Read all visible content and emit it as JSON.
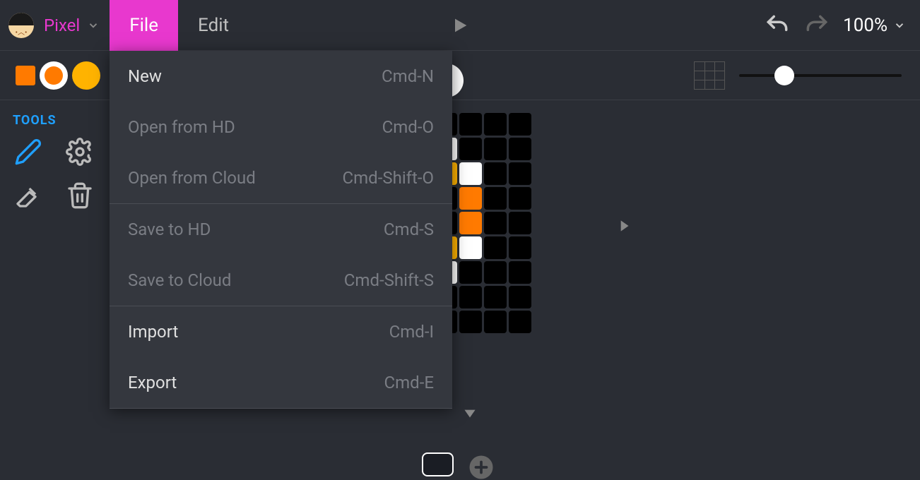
{
  "menubar": {
    "mode_label": "Pixel",
    "tabs": {
      "file": "File",
      "edit": "Edit"
    },
    "zoom_label": "100%"
  },
  "optionsbar": {
    "swatch_square_color": "#ff7a00",
    "swatch_circle_white_inner": "#ff7a00",
    "swatch_circle_orange": "#ffb300"
  },
  "tools": {
    "title": "TOOLS"
  },
  "file_menu": [
    {
      "label": "New",
      "shortcut": "Cmd-N",
      "disabled": false
    },
    {
      "label": "Open from HD",
      "shortcut": "Cmd-O",
      "disabled": true
    },
    {
      "label": "Open from Cloud",
      "shortcut": "Cmd-Shift-O",
      "disabled": true
    },
    {
      "divider": true
    },
    {
      "label": "Save to HD",
      "shortcut": "Cmd-S",
      "disabled": true
    },
    {
      "label": "Save to Cloud",
      "shortcut": "Cmd-Shift-S",
      "disabled": true
    },
    {
      "divider": true
    },
    {
      "label": "Import",
      "shortcut": "Cmd-I",
      "disabled": false
    },
    {
      "label": "Export",
      "shortcut": "Cmd-E",
      "disabled": false
    },
    {
      "divider": true
    }
  ],
  "pixel_grid": {
    "rows": 9,
    "cols": 9,
    "colors": {
      "k": "#000000",
      "w": "#ffffff",
      "o": "#ff7a00",
      "y": "#ffb300"
    },
    "data": [
      [
        "k",
        "k",
        "k",
        "k",
        "k",
        "k",
        "k",
        "k",
        "k"
      ],
      [
        "k",
        "k",
        "k",
        "k",
        "w",
        "w",
        "k",
        "k",
        "k"
      ],
      [
        "k",
        "k",
        "k",
        "k",
        "k",
        "y",
        "w",
        "k",
        "k"
      ],
      [
        "k",
        "k",
        "k",
        "k",
        "k",
        "k",
        "o",
        "k",
        "k"
      ],
      [
        "k",
        "k",
        "k",
        "k",
        "k",
        "k",
        "o",
        "k",
        "k"
      ],
      [
        "k",
        "k",
        "k",
        "k",
        "k",
        "y",
        "w",
        "k",
        "k"
      ],
      [
        "k",
        "k",
        "k",
        "k",
        "w",
        "w",
        "k",
        "k",
        "k"
      ],
      [
        "k",
        "k",
        "k",
        "k",
        "w",
        "k",
        "k",
        "k",
        "k"
      ],
      [
        "k",
        "k",
        "k",
        "k",
        "w",
        "k",
        "k",
        "k",
        "k"
      ]
    ]
  }
}
